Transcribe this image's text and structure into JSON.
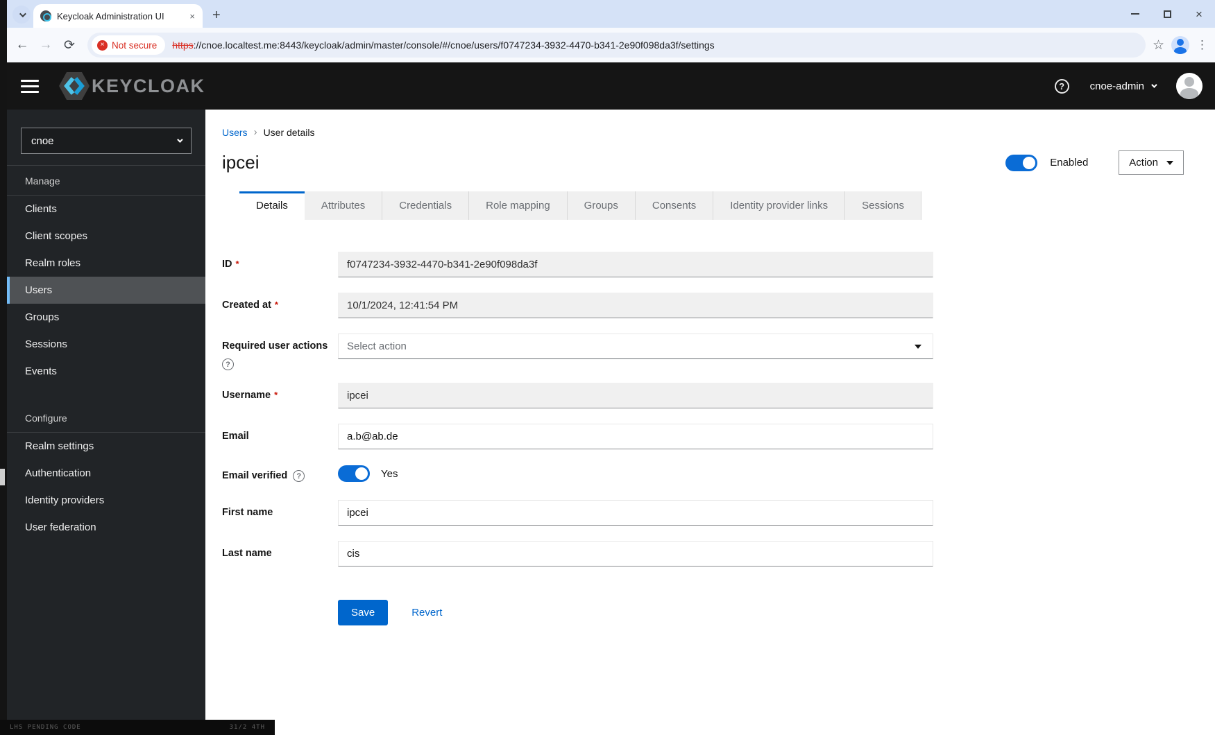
{
  "browser": {
    "tab_title": "Keycloak Administration UI",
    "address": {
      "security_label": "Not secure",
      "scheme": "https",
      "url_rest": "://cnoe.localtest.me:8443/keycloak/admin/master/console/#/cnoe/users/f0747234-3932-4470-b341-2e90f098da3f/settings"
    }
  },
  "icons": {
    "back": "←",
    "forward": "→",
    "reload": "⟳",
    "star": "☆",
    "menu_dots": "⋮",
    "new_tab": "+",
    "close": "×",
    "error": "×",
    "help": "?",
    "breadcrumb_separator": "›"
  },
  "masthead": {
    "brand": "KEYCLOAK",
    "user": "cnoe-admin"
  },
  "sidebar": {
    "realm_selector": "cnoe",
    "sections": [
      {
        "label": "Manage",
        "items": [
          "Clients",
          "Client scopes",
          "Realm roles",
          "Users",
          "Groups",
          "Sessions",
          "Events"
        ]
      },
      {
        "label": "Configure",
        "items": [
          "Realm settings",
          "Authentication",
          "Identity providers",
          "User federation"
        ]
      }
    ],
    "selected_item": "Users"
  },
  "page": {
    "breadcrumb": {
      "parent": "Users",
      "current": "User details"
    },
    "title": "ipcei",
    "enabled_label": "Enabled",
    "action_button": "Action",
    "tabs": [
      "Details",
      "Attributes",
      "Credentials",
      "Role mapping",
      "Groups",
      "Consents",
      "Identity provider links",
      "Sessions"
    ],
    "active_tab": "Details",
    "form": {
      "required_marker": "*",
      "id": {
        "label": "ID",
        "value": "f0747234-3932-4470-b341-2e90f098da3f"
      },
      "created_at": {
        "label": "Created at",
        "value": "10/1/2024, 12:41:54 PM"
      },
      "required_user_actions": {
        "label": "Required user actions",
        "placeholder": "Select action"
      },
      "username": {
        "label": "Username",
        "value": "ipcei"
      },
      "email": {
        "label": "Email",
        "value": "a.b@ab.de"
      },
      "email_verified": {
        "label": "Email verified",
        "value": "Yes"
      },
      "first_name": {
        "label": "First name",
        "value": "ipcei"
      },
      "last_name": {
        "label": "Last name",
        "value": "cis"
      }
    },
    "buttons": {
      "save": "Save",
      "revert": "Revert"
    }
  },
  "colors": {
    "accent": "#0066cc",
    "masthead_bg": "#151515",
    "sidebar_bg": "#212427",
    "selected_item_border": "#73bcf7",
    "required": "#c9190b",
    "not_secure": "#d93025"
  },
  "artifacts": {
    "bottom_left": "LHS PENDING   CODE",
    "bottom_right": "31/2   4TH"
  }
}
